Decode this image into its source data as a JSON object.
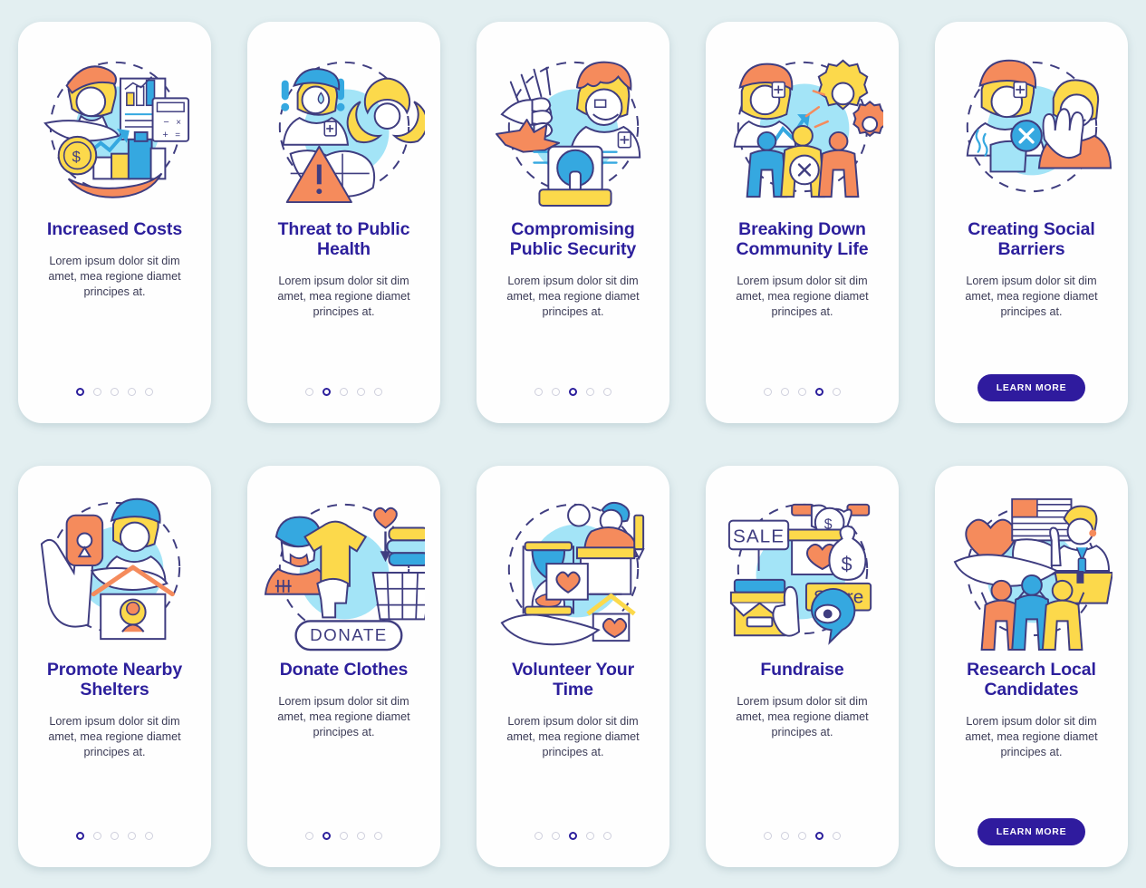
{
  "page": {
    "background_color": "#e3eff1",
    "card_background": "#fefefe",
    "title_color": "#2c1f9c",
    "body_color": "#3b3b56",
    "accent_color": "#2f1b9e",
    "dot_inactive_color": "#cfd0dd",
    "palette": {
      "orange": "#f58b5c",
      "yellow": "#fcd94b",
      "light_blue": "#7fd8f7",
      "blue": "#35a8e0",
      "navy_line": "#3f3d80",
      "white": "#ffffff",
      "cyan_blob": "#a3e4f7"
    }
  },
  "common": {
    "body_text": "Lorem ipsum dolor sit dim amet, mea regione diamet principes at.",
    "learn_more_label": "LEARN MORE"
  },
  "cards": [
    {
      "id": "increased-costs",
      "title": "Increased Costs",
      "body": "Lorem ipsum dolor sit dim amet, mea regione diamet principes at.",
      "dots_total": 5,
      "dot_active": 1,
      "has_button": false,
      "illustration": "costs-person-chart-calculator-coin-icon",
      "illustration_texts": []
    },
    {
      "id": "threat-to-public-health",
      "title": "Threat to Public Health",
      "body": "Lorem ipsum dolor sit dim amet, mea regione diamet principes at.",
      "dots_total": 5,
      "dot_active": 2,
      "has_button": false,
      "illustration": "health-biohazard-warning-icon",
      "illustration_texts": []
    },
    {
      "id": "compromising-public-security",
      "title": "Compromising Public Security",
      "body": "Lorem ipsum dolor sit dim amet, mea regione diamet principes at.",
      "dots_total": 5,
      "dot_active": 3,
      "has_button": false,
      "illustration": "security-fist-siren-icon",
      "illustration_texts": []
    },
    {
      "id": "breaking-down-community-life",
      "title": "Breaking Down Community Life",
      "body": "Lorem ipsum dolor sit dim amet, mea regione diamet principes at.",
      "dots_total": 5,
      "dot_active": 4,
      "has_button": false,
      "illustration": "community-gears-people-icon",
      "illustration_texts": []
    },
    {
      "id": "creating-social-barriers",
      "title": "Creating Social Barriers",
      "body": "Lorem ipsum dolor sit dim amet, mea regione diamet principes at.",
      "dots_total": 0,
      "dot_active": 0,
      "has_button": true,
      "button_label": "LEARN MORE",
      "illustration": "social-barriers-rejection-hand-icon",
      "illustration_texts": []
    },
    {
      "id": "promote-nearby-shelters",
      "title": "Promote Nearby Shelters",
      "body": "Lorem ipsum dolor sit dim amet, mea regione diamet principes at.",
      "dots_total": 5,
      "dot_active": 1,
      "has_button": false,
      "illustration": "shelter-map-pin-house-hand-icon",
      "illustration_texts": []
    },
    {
      "id": "donate-clothes",
      "title": "Donate Clothes",
      "body": "Lorem ipsum dolor sit dim amet, mea regione diamet principes at.",
      "dots_total": 5,
      "dot_active": 2,
      "has_button": false,
      "illustration": "donate-clothes-basket-icon",
      "illustration_texts": [
        "DONATE"
      ]
    },
    {
      "id": "volunteer-your-time",
      "title": "Volunteer Your Time",
      "body": "Lorem ipsum dolor sit dim amet, mea regione diamet principes at.",
      "dots_total": 5,
      "dot_active": 3,
      "has_button": false,
      "illustration": "volunteer-hourglass-hand-house-icon",
      "illustration_texts": []
    },
    {
      "id": "fundraise",
      "title": "Fundraise",
      "body": "Lorem ipsum dolor sit dim amet, mea regione diamet principes at.",
      "dots_total": 5,
      "dot_active": 4,
      "has_button": false,
      "illustration": "fundraise-sale-share-money-icon",
      "illustration_texts": [
        "SALE",
        "Share"
      ]
    },
    {
      "id": "research-local-candidates",
      "title": "Research Local Candidates",
      "body": "Lorem ipsum dolor sit dim amet, mea regione diamet principes at.",
      "dots_total": 0,
      "dot_active": 0,
      "has_button": true,
      "button_label": "LEARN MORE",
      "illustration": "research-candidates-flag-podium-people-icon",
      "illustration_texts": []
    }
  ]
}
